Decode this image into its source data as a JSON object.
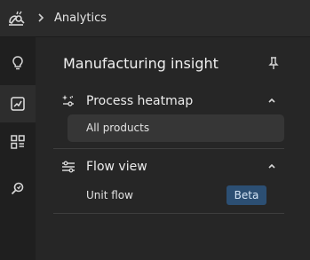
{
  "header": {
    "breadcrumb": "Analytics",
    "logo_icon": "bee-logo-icon",
    "chevron_icon": "chevron-right-icon"
  },
  "rail": {
    "items": [
      {
        "icon": "lightbulb-icon",
        "active": false
      },
      {
        "icon": "chart-trend-icon",
        "active": true
      },
      {
        "icon": "dashboard-grid-icon",
        "active": false
      },
      {
        "icon": "search-inspect-icon",
        "active": false
      }
    ]
  },
  "panel": {
    "title": "Manufacturing insight",
    "pin_icon": "pin-icon",
    "sections": [
      {
        "label": "Process heatmap",
        "icon": "sparkle-settings-icon",
        "expanded": true,
        "items": [
          {
            "label": "All products",
            "selected": true
          }
        ]
      },
      {
        "label": "Flow view",
        "icon": "flow-lines-icon",
        "expanded": true,
        "items": [
          {
            "label": "Unit flow",
            "badge": "Beta"
          }
        ]
      }
    ]
  },
  "colors": {
    "background": "#262626",
    "rail": "#1f1f1f",
    "selected_item": "#363636",
    "badge_bg": "#2c4f73",
    "badge_text": "#d6e6f7"
  }
}
